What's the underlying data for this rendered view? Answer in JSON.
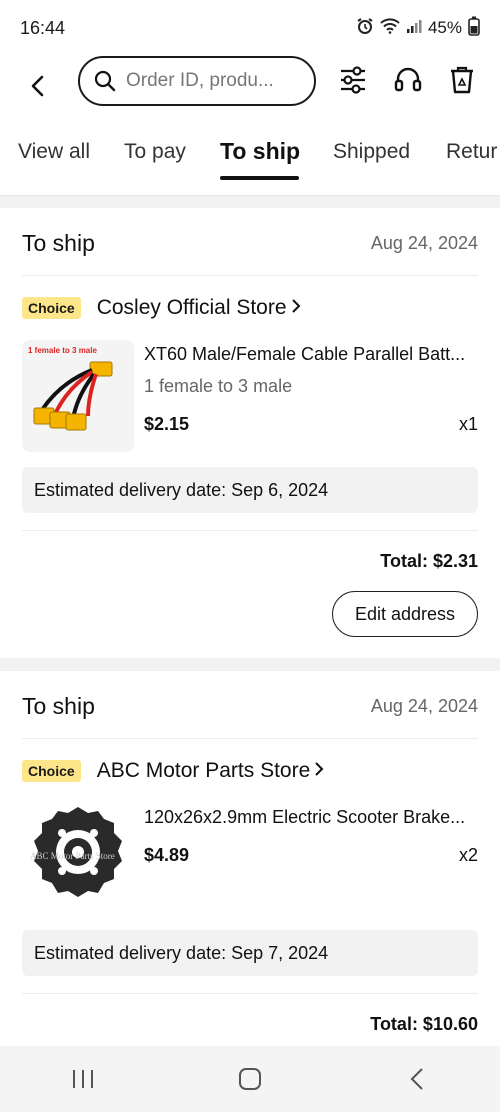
{
  "status_bar": {
    "time": "16:44",
    "battery": "45%"
  },
  "search": {
    "placeholder": "Order ID, produ..."
  },
  "tabs": [
    {
      "label": "View all"
    },
    {
      "label": "To pay"
    },
    {
      "label": "To ship",
      "active": true
    },
    {
      "label": "Shipped"
    },
    {
      "label": "Retur"
    }
  ],
  "orders": [
    {
      "status": "To ship",
      "date": "Aug 24, 2024",
      "badge": "Choice",
      "store": "Cosley Official Store",
      "product_title": "XT60 Male/Female Cable Parallel Batt...",
      "variant": "1 female to 3 male",
      "image_caption": "1 female to 3 male",
      "price": "$2.15",
      "qty": "x1",
      "delivery": "Estimated delivery date: Sep 6, 2024",
      "total": "Total: $2.31",
      "action": "Edit address"
    },
    {
      "status": "To ship",
      "date": "Aug 24, 2024",
      "badge": "Choice",
      "store": "ABC Motor Parts Store",
      "product_title": "120x26x2.9mm Electric Scooter Brake...",
      "image_caption": "ABC Motor Parts Store",
      "price": "$4.89",
      "qty": "x2",
      "delivery": "Estimated delivery date: Sep 7, 2024",
      "total": "Total: $10.60"
    }
  ],
  "colors": {
    "choice_badge": "#fde68a",
    "background": "#f2f2f2",
    "accent": "#111111"
  }
}
